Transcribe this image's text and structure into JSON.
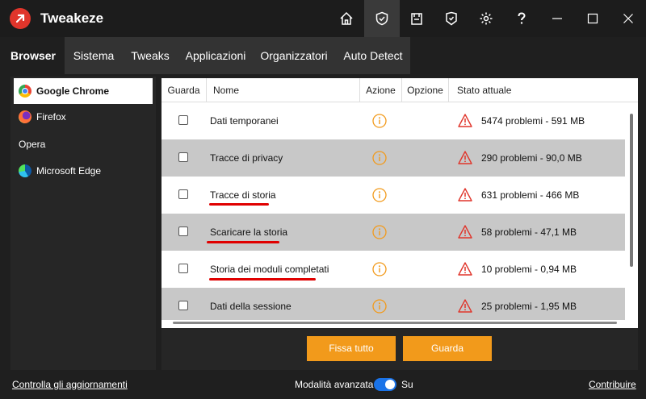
{
  "window": {
    "title": "Tweakeze",
    "toolbar_icons": [
      "home-icon",
      "shield-icon",
      "store-icon",
      "badge-icon",
      "gear-icon",
      "help-icon",
      "minimize-icon",
      "maximize-icon",
      "close-icon"
    ]
  },
  "menu": {
    "items": [
      "Browser",
      "Sistema",
      "Tweaks",
      "Applicazioni",
      "Organizzatori",
      "Auto Detect"
    ],
    "active": "Browser"
  },
  "sidebar": {
    "items": [
      {
        "label": "Google Chrome",
        "selected": true,
        "icon": "chrome-icon"
      },
      {
        "label": "Firefox",
        "selected": false,
        "icon": "firefox-icon"
      },
      {
        "label": "Opera",
        "selected": false,
        "icon": ""
      },
      {
        "label": "Microsoft Edge",
        "selected": false,
        "icon": "edge-icon"
      }
    ]
  },
  "table": {
    "headers": [
      "Guarda",
      "Nome",
      "Azione",
      "Opzione",
      "Stato attuale"
    ],
    "rows": [
      {
        "name": "Dati temporanei",
        "status": "5474 problemi - 591 MB",
        "checked": false
      },
      {
        "name": "Tracce di privacy",
        "status": "290 problemi - 90,0 MB",
        "checked": false
      },
      {
        "name": "Tracce di storia",
        "status": "631 problemi - 466 MB",
        "checked": false
      },
      {
        "name": "Scaricare la storia",
        "status": "58 problemi - 47,1 MB",
        "checked": false
      },
      {
        "name": "Storia dei moduli completati",
        "status": "10 problemi - 0,94 MB",
        "checked": false
      },
      {
        "name": "Dati della sessione",
        "status": "25 problemi - 1,95 MB",
        "checked": false
      }
    ]
  },
  "actions": {
    "fix_all": "Fissa tutto",
    "scan": "Guarda"
  },
  "footer": {
    "check_updates": "Controlla gli aggiornamenti",
    "advanced_mode_label": "Modalità avanzata",
    "advanced_mode_state": "Su",
    "contribute": "Contribuire"
  },
  "colors": {
    "accent": "#f29a1b",
    "warning": "#e0352b",
    "toggle": "#1a73e8",
    "annotation": "#e00000"
  }
}
